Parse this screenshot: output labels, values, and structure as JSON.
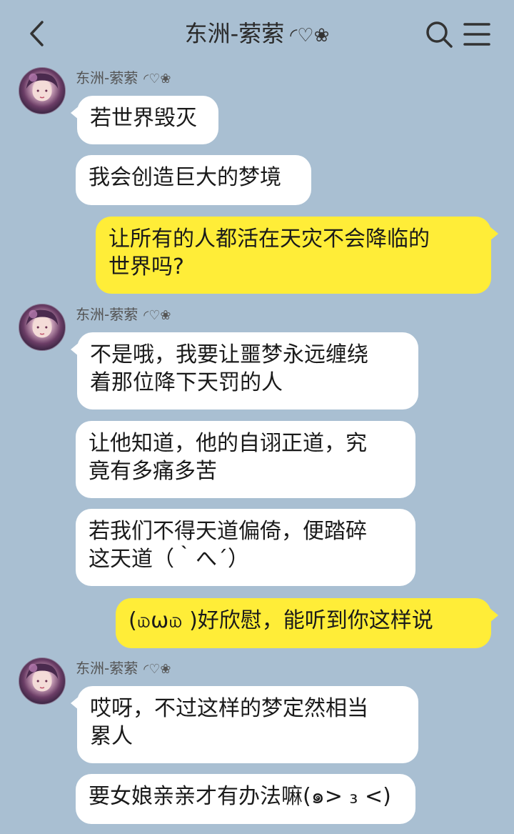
{
  "header": {
    "title": "东洲-萦萦",
    "title_deco": "◜♡❀"
  },
  "colors": {
    "background": "#a9bfd2",
    "incoming_bubble": "#ffffff",
    "outgoing_bubble": "#ffed38"
  },
  "icons": {
    "back": "chevron-left-icon",
    "search": "search-icon",
    "menu": "menu-icon"
  },
  "messages": [
    {
      "sender": "东洲-萦萦",
      "sender_deco": "◜♡❀",
      "direction": "in",
      "lines": [
        "若世界毁灭"
      ]
    },
    {
      "direction": "in",
      "lines": [
        "我会创造巨大的梦境"
      ]
    },
    {
      "direction": "out",
      "lines": [
        "让所有的人都活在天灾不会降临的",
        "世界吗?"
      ]
    },
    {
      "sender": "东洲-萦萦",
      "sender_deco": "◜♡❀",
      "direction": "in",
      "lines": [
        "不是哦，我要让噩梦永远缠绕",
        "着那位降下天罚的人"
      ]
    },
    {
      "direction": "in",
      "lines": [
        "让他知道，他的自诩正道，究",
        "竟有多痛多苦"
      ]
    },
    {
      "direction": "in",
      "lines": [
        "若我们不得天道偏倚，便踏碎",
        "这天道（｀へ´）"
      ]
    },
    {
      "direction": "out",
      "lines": [
        "(௰ω௰ )好欣慰，能听到你这样说"
      ]
    },
    {
      "sender": "东洲-萦萦",
      "sender_deco": "◜♡❀",
      "direction": "in",
      "lines": [
        "哎呀，不过这样的梦定然相当",
        "累人"
      ]
    },
    {
      "direction": "in",
      "lines": [
        "要女娘亲亲才有办法嘛(๑> ₃ <)"
      ]
    }
  ]
}
